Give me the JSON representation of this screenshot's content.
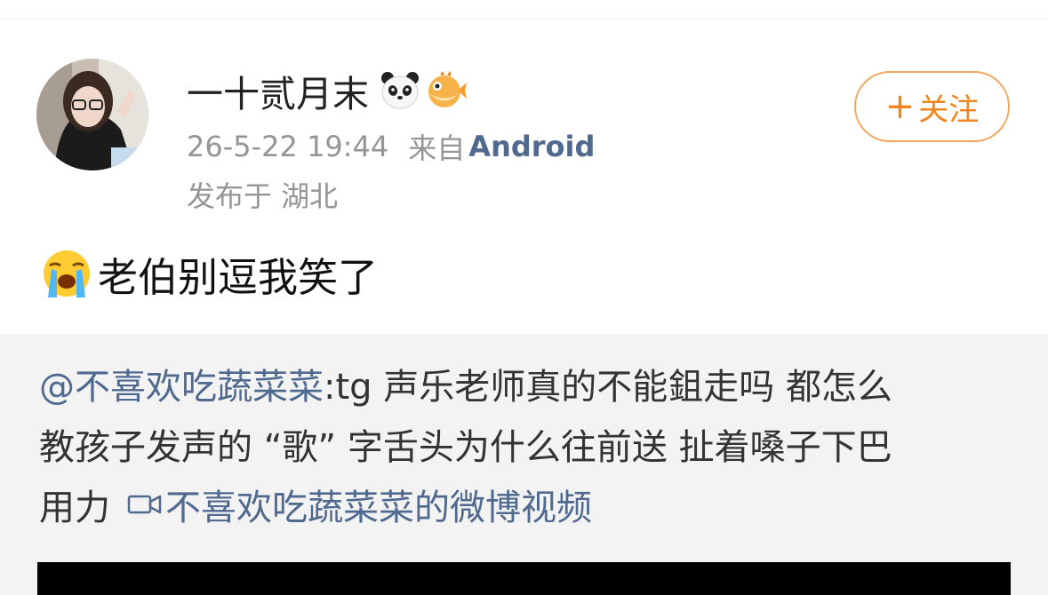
{
  "post": {
    "user": {
      "name": "一十贰月末",
      "badges": [
        "panda-icon",
        "pufferfish-icon"
      ]
    },
    "timestamp": "26-5-22 19:44",
    "source_prefix": "来自",
    "source_client": "Android",
    "location": "发布于 湖北",
    "follow_label": "关注",
    "follow_icon": "+",
    "text_emoji": "crying-face-icon",
    "text": "老伯别逗我笑了"
  },
  "repost": {
    "mention": "@不喜欢吃蔬菜菜",
    "line1_rest": ":tg 声乐老师真的不能鉏走吗 都怎么",
    "line2": "教孩子发声的 “歌” 字舌头为什么往前送 扯着嗓子下巴",
    "line3": "用力",
    "video_link": "不喜欢吃蔬菜菜的微博视频"
  },
  "colors": {
    "link": "#50698f",
    "follow": "#f0841f",
    "meta": "#959595",
    "repost_bg": "#f3f3f3"
  }
}
